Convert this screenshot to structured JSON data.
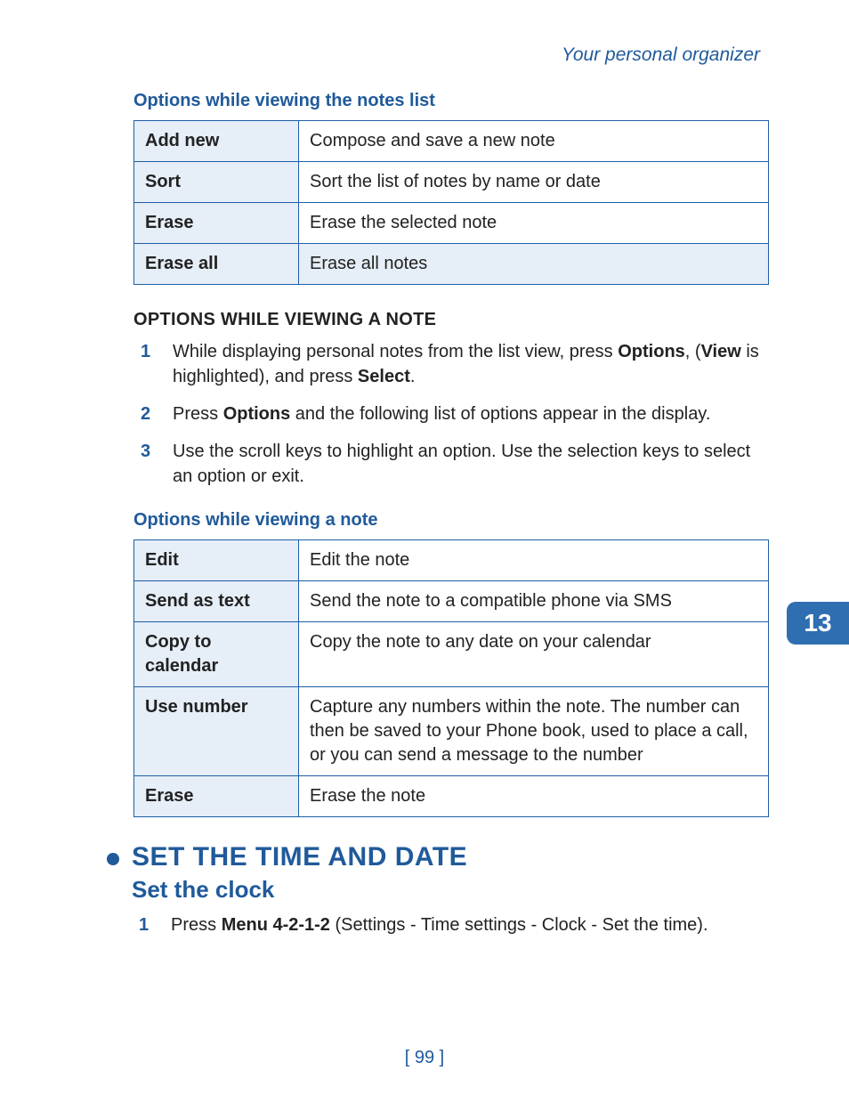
{
  "running_head": "Your personal organizer",
  "chapter_tab": "13",
  "page_number": "[ 99 ]",
  "table1": {
    "caption": "Options while viewing the notes list",
    "rows": [
      {
        "key": "Add new",
        "val": "Compose and save a new note"
      },
      {
        "key": "Sort",
        "val": "Sort the list of notes by name or date"
      },
      {
        "key": "Erase",
        "val": "Erase the selected note"
      },
      {
        "key": "Erase all",
        "val": "Erase all notes"
      }
    ]
  },
  "subhead1": "OPTIONS WHILE VIEWING A NOTE",
  "steps1": {
    "s1_a": "While displaying personal notes from the list view, press ",
    "s1_b": "Options",
    "s1_c": ", (",
    "s1_d": "View",
    "s1_e": " is highlighted), and press ",
    "s1_f": "Select",
    "s1_g": ".",
    "s2_a": "Press ",
    "s2_b": "Options",
    "s2_c": " and the following list of options appear in the display.",
    "s3": "Use the scroll keys to highlight an option. Use the selection keys to select an option or exit."
  },
  "table2": {
    "caption": "Options while viewing a note",
    "rows": [
      {
        "key": "Edit",
        "val": "Edit the note"
      },
      {
        "key": "Send as text",
        "val": "Send the note to a compatible phone via SMS"
      },
      {
        "key": "Copy to calendar",
        "val": "Copy the note to any date on your calendar"
      },
      {
        "key": "Use number",
        "val": "Capture any numbers within the note. The number can then be saved to your Phone book, used to place a call, or you can send a message to the number"
      },
      {
        "key": "Erase",
        "val": "Erase the note"
      }
    ]
  },
  "section": {
    "h1": "SET THE TIME AND DATE",
    "h2": "Set the clock"
  },
  "steps2": {
    "s1_a": "Press ",
    "s1_b": "Menu 4-2-1-2",
    "s1_c": " (Settings - Time settings - Clock - Set the time)."
  }
}
